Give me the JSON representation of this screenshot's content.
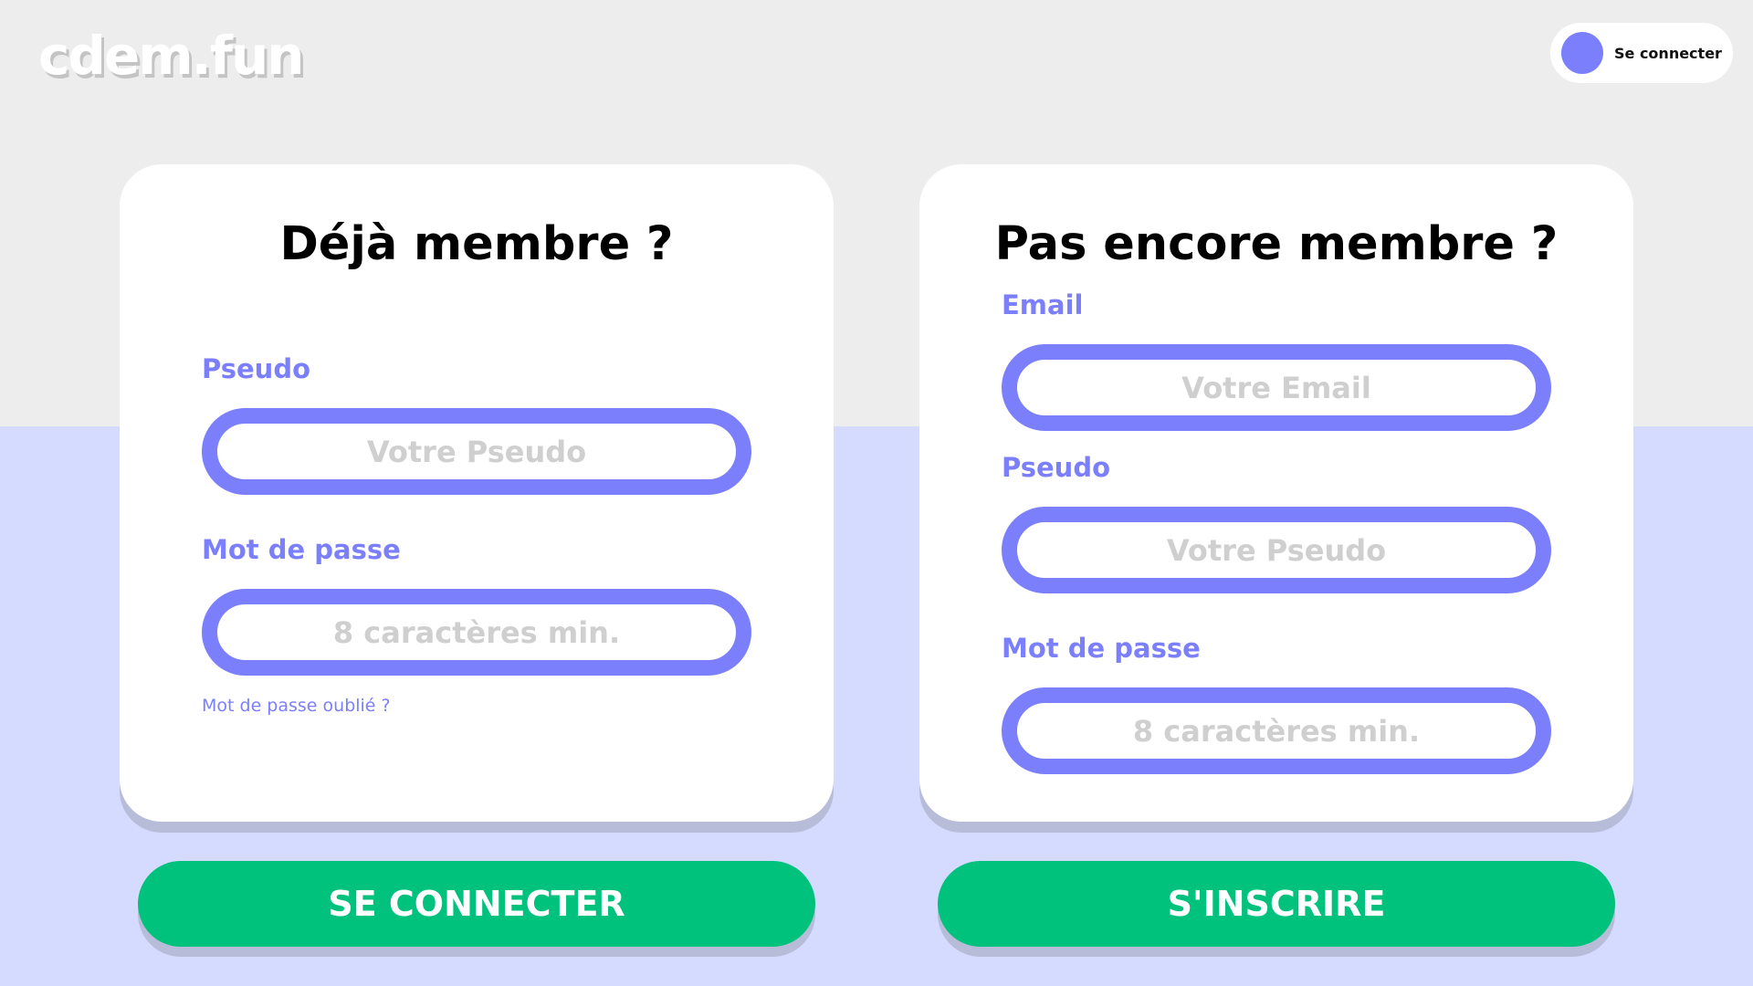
{
  "header": {
    "logo": "cdem.fun",
    "login_label": "Se connecter"
  },
  "login": {
    "title": "Déjà membre ?",
    "pseudo_label": "Pseudo",
    "pseudo_placeholder": "Votre Pseudo",
    "password_label": "Mot de passe",
    "password_placeholder": "8 caractères min.",
    "forgot": "Mot de passe oublié ?",
    "submit": "SE CONNECTER"
  },
  "signup": {
    "title": "Pas encore membre ?",
    "email_label": "Email",
    "email_placeholder": "Votre Email",
    "pseudo_label": "Pseudo",
    "pseudo_placeholder": "Votre Pseudo",
    "password_label": "Mot de passe",
    "password_placeholder": "8 caractères min.",
    "submit": "S'INSCRIRE"
  },
  "colors": {
    "accent": "#7b7ffb",
    "success": "#00c27c",
    "background_top": "#ededed",
    "background_bottom": "#d5dbff"
  }
}
